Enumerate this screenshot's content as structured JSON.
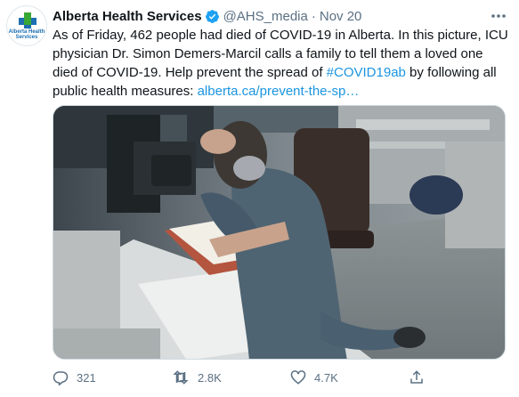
{
  "tweet": {
    "author": {
      "display_name": "Alberta Health Services",
      "verified": true,
      "handle": "@AHS_media",
      "avatar_text": "Alberta Health Services"
    },
    "separator": "·",
    "date": "Nov 20",
    "text": {
      "part1": "As of Friday, 462 people had died of COVID-19 in Alberta. In this picture, ICU physician Dr. Simon Demers-Marcil calls a family to tell them a loved one died of COVID-19. Help prevent the spread of ",
      "hashtag": "#COVID19ab",
      "part2": " by following all public health measures: ",
      "link": "alberta.ca/prevent-the-sp…"
    },
    "actions": {
      "replies": "321",
      "retweets": "2.8K",
      "likes": "4.7K"
    }
  },
  "icons": {
    "more": "more-horizontal-icon",
    "reply": "reply-icon",
    "retweet": "retweet-icon",
    "like": "heart-icon",
    "share": "share-icon",
    "verified": "verified-badge-icon"
  },
  "colors": {
    "link": "#1b95e0",
    "secondary_text": "#5b7083",
    "verified": "#1da1f2",
    "logo_blue": "#1c6fb1",
    "logo_green": "#3aa835"
  }
}
